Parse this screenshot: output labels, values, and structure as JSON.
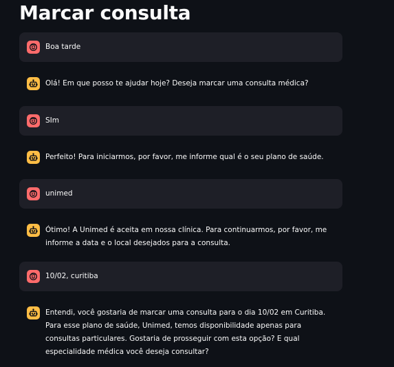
{
  "page": {
    "title": "Marcar consulta"
  },
  "colors": {
    "background": "#0e1117",
    "user_bubble": "#1e1f27",
    "user_avatar": "#ff6b6b",
    "assistant_avatar": "#ffbd45",
    "text": "#fafafa"
  },
  "messages": [
    {
      "role": "user",
      "avatar_icon": "user-face-icon",
      "text": "Boa tarde"
    },
    {
      "role": "assistant",
      "avatar_icon": "robot-icon",
      "text": "Olá! Em que posso te ajudar hoje? Deseja marcar uma consulta médica?"
    },
    {
      "role": "user",
      "avatar_icon": "user-face-icon",
      "text": "SIm"
    },
    {
      "role": "assistant",
      "avatar_icon": "robot-icon",
      "text": "Perfeito! Para iniciarmos, por favor, me informe qual é o seu plano de saúde."
    },
    {
      "role": "user",
      "avatar_icon": "user-face-icon",
      "text": "unimed"
    },
    {
      "role": "assistant",
      "avatar_icon": "robot-icon",
      "text": "Ótimo! A Unimed é aceita em nossa clínica. Para continuarmos, por favor, me informe a data e o local desejados para a consulta."
    },
    {
      "role": "user",
      "avatar_icon": "user-face-icon",
      "text": "10/02, curitiba"
    },
    {
      "role": "assistant",
      "avatar_icon": "robot-icon",
      "text": "Entendi, você gostaria de marcar uma consulta para o dia 10/02 em Curitiba. Para esse plano de saúde, Unimed, temos disponibilidade apenas para consultas particulares. Gostaria de prosseguir com esta opção? E qual especialidade médica você deseja consultar?"
    }
  ]
}
